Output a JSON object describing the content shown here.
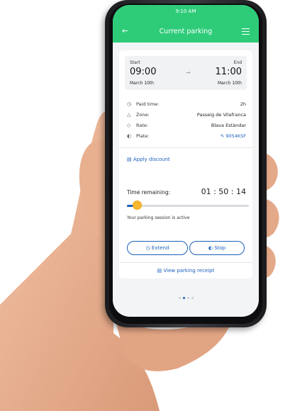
{
  "status_bar": {
    "time": "9:10 AM"
  },
  "header": {
    "title": "Current parking",
    "back_icon": "back-arrow-icon",
    "menu_icon": "hamburger-menu-icon",
    "color": "#2ecc79"
  },
  "session": {
    "start_label": "Start",
    "start_time": "09:00",
    "start_date": "March 10th",
    "end_label": "End",
    "end_time": "11:00",
    "end_date": "March 10th"
  },
  "details": [
    {
      "icon": "clock-icon",
      "label": "Paid time:",
      "value": "2h"
    },
    {
      "icon": "zone-icon",
      "label": "Zone:",
      "value": "Passeig de Vilafranca"
    },
    {
      "icon": "tag-icon",
      "label": "Rate:",
      "value": "Blava Estàndar"
    },
    {
      "icon": "car-icon",
      "label": "Plate:",
      "value": "9054KSF"
    }
  ],
  "apply_discount": "Apply discount",
  "time_remaining": {
    "label": "Time remaining:",
    "value": "01 : 50 : 14",
    "progress": 0.08
  },
  "status_message": "Your parking session is active",
  "buttons": {
    "extend": "Extend",
    "stop": "Stop"
  },
  "receipt_link": "View parking receipt",
  "pagination": {
    "count": 4,
    "active": 1
  },
  "colors": {
    "accent": "#1b5fbd",
    "knob": "#f7b731"
  }
}
